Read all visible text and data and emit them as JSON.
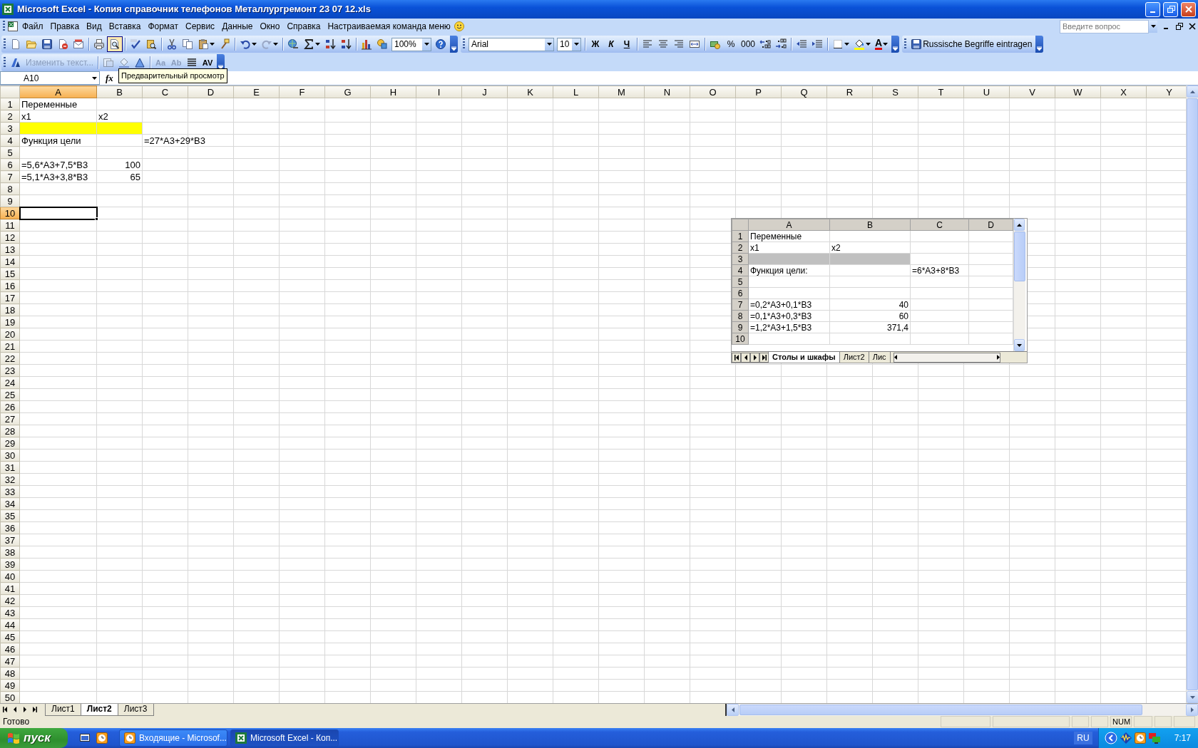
{
  "window": {
    "title": "Microsoft Excel - Копия справочник телефонов Металлургремонт 23 07 12.xls"
  },
  "menu_bar": {
    "items": [
      "Файл",
      "Правка",
      "Вид",
      "Вставка",
      "Формат",
      "Сервис",
      "Данные",
      "Окно",
      "Справка",
      "Настраиваемая команда меню"
    ],
    "help_placeholder": "Введите вопрос"
  },
  "standard_toolbar": {
    "groups": [
      [
        {
          "kind": "new",
          "hovered": false
        },
        {
          "kind": "open",
          "hovered": false
        },
        {
          "kind": "save",
          "hovered": false
        },
        {
          "kind": "permission",
          "hovered": false
        },
        {
          "kind": "email",
          "hovered": false
        }
      ],
      [
        {
          "kind": "print",
          "hovered": false
        },
        {
          "kind": "preview",
          "hovered": true
        }
      ],
      [
        {
          "kind": "spelling",
          "hovered": false
        },
        {
          "kind": "research",
          "hovered": false
        }
      ],
      [
        {
          "kind": "cut",
          "hovered": false
        },
        {
          "kind": "copy",
          "hovered": false
        },
        {
          "kind": "paste",
          "hovered": false
        },
        {
          "kind": "painter",
          "hovered": false
        }
      ],
      [
        {
          "kind": "undo",
          "hovered": false
        },
        {
          "kind": "redo",
          "hovered": false
        }
      ],
      [
        {
          "kind": "hyperlink",
          "hovered": false
        },
        {
          "kind": "autosum",
          "hovered": false
        },
        {
          "kind": "sort-asc",
          "hovered": false
        },
        {
          "kind": "sort-desc",
          "hovered": false
        }
      ],
      [
        {
          "kind": "chart",
          "hovered": false
        },
        {
          "kind": "drawing",
          "hovered": false
        },
        {
          "kind": "zoom",
          "value": "100%",
          "hovered": false
        },
        {
          "kind": "help",
          "hovered": false
        }
      ]
    ]
  },
  "formatting_toolbar": {
    "groups": [
      [
        {
          "kind": "font-combo",
          "value": "Arial"
        },
        {
          "kind": "size-combo",
          "value": "10"
        }
      ],
      [
        {
          "kind": "bold",
          "text": "Ж"
        },
        {
          "kind": "italic",
          "text": "К"
        },
        {
          "kind": "underline",
          "text": "Ч"
        }
      ],
      [
        {
          "kind": "align-left"
        },
        {
          "kind": "align-center"
        },
        {
          "kind": "align-right"
        },
        {
          "kind": "merge"
        }
      ],
      [
        {
          "kind": "currency"
        },
        {
          "kind": "percent",
          "text": "%"
        },
        {
          "kind": "thousands",
          "text": "000"
        },
        {
          "kind": "inc-decimal"
        },
        {
          "kind": "dec-decimal"
        }
      ],
      [
        {
          "kind": "dec-indent"
        },
        {
          "kind": "inc-indent"
        }
      ],
      [
        {
          "kind": "borders"
        },
        {
          "kind": "fill-color"
        },
        {
          "kind": "font-color",
          "text": "A"
        }
      ]
    ]
  },
  "custom_toolbar": {
    "button": "Russische Begriffe eintragen"
  },
  "wordart_toolbar": {
    "groups": [
      [
        {
          "kind": "wordart",
          "disabled": false
        },
        {
          "kind": "edit-text",
          "text": "Изменить текст...",
          "disabled": true
        }
      ],
      [
        {
          "kind": "gallery",
          "disabled": true
        },
        {
          "kind": "format",
          "disabled": true
        },
        {
          "kind": "shape",
          "disabled": false
        }
      ],
      [
        {
          "kind": "same-height",
          "text": "Aa",
          "disabled": true
        },
        {
          "kind": "vertical",
          "text": "Ab",
          "disabled": true
        },
        {
          "kind": "alignment",
          "disabled": false
        },
        {
          "kind": "spacing",
          "text": "AV",
          "disabled": false
        }
      ]
    ]
  },
  "tooltip": {
    "text": "Предварительный просмотр"
  },
  "formula_bar": {
    "name_box": "A10",
    "fx": "fx"
  },
  "sheet": {
    "columns": [
      {
        "label": "A",
        "selected": true
      },
      {
        "label": "B",
        "selected": false
      },
      {
        "label": "C",
        "selected": false
      },
      {
        "label": "D",
        "selected": false
      },
      {
        "label": "E",
        "selected": false
      },
      {
        "label": "F",
        "selected": false
      },
      {
        "label": "G",
        "selected": false
      },
      {
        "label": "H",
        "selected": false
      },
      {
        "label": "I",
        "selected": false
      },
      {
        "label": "J",
        "selected": false
      },
      {
        "label": "K",
        "selected": false
      },
      {
        "label": "L",
        "selected": false
      },
      {
        "label": "M",
        "selected": false
      },
      {
        "label": "N",
        "selected": false
      },
      {
        "label": "O",
        "selected": false
      },
      {
        "label": "P",
        "selected": false
      },
      {
        "label": "Q",
        "selected": false
      },
      {
        "label": "R",
        "selected": false
      },
      {
        "label": "S",
        "selected": false
      },
      {
        "label": "T",
        "selected": false
      },
      {
        "label": "U",
        "selected": false
      },
      {
        "label": "V",
        "selected": false
      },
      {
        "label": "W",
        "selected": false
      },
      {
        "label": "X",
        "selected": false
      },
      {
        "label": "Y",
        "selected": false
      }
    ],
    "rows": [
      {
        "label": "1",
        "selected": false,
        "cells": [
          {
            "kind": "text",
            "text": "Переменные",
            "highlighted": false,
            "active": false
          }
        ]
      },
      {
        "label": "2",
        "selected": false,
        "cells": [
          {
            "kind": "text",
            "text": "x1",
            "highlighted": false,
            "active": false
          },
          {
            "kind": "text",
            "text": "x2",
            "highlighted": false,
            "active": false
          }
        ]
      },
      {
        "label": "3",
        "selected": false,
        "cells": [
          {
            "kind": "empty",
            "highlighted": true,
            "active": false
          },
          {
            "kind": "empty",
            "highlighted": true,
            "active": false
          }
        ]
      },
      {
        "label": "4",
        "selected": false,
        "cells": [
          {
            "kind": "text",
            "text": "Функция цели",
            "highlighted": false,
            "active": false
          },
          null,
          {
            "kind": "text",
            "text": "=27*A3+29*B3",
            "highlighted": false,
            "active": false
          }
        ]
      },
      {
        "label": "5",
        "selected": false
      },
      {
        "label": "6",
        "selected": false,
        "cells": [
          {
            "kind": "text",
            "text": "=5,6*A3+7,5*B3",
            "highlighted": false,
            "active": false
          },
          {
            "kind": "number",
            "text": "100",
            "highlighted": false,
            "active": false
          }
        ]
      },
      {
        "label": "7",
        "selected": false,
        "cells": [
          {
            "kind": "text",
            "text": "=5,1*A3+3,8*B3",
            "highlighted": false,
            "active": false
          },
          {
            "kind": "number",
            "text": "65",
            "highlighted": false,
            "active": false
          }
        ]
      },
      {
        "label": "8",
        "selected": false
      },
      {
        "label": "9",
        "selected": false
      },
      {
        "label": "10",
        "selected": true,
        "cells": [
          {
            "kind": "empty",
            "highlighted": false,
            "active": true
          }
        ]
      },
      {
        "label": "11",
        "selected": false
      },
      {
        "label": "12",
        "selected": false
      },
      {
        "label": "13",
        "selected": false
      },
      {
        "label": "14",
        "selected": false
      },
      {
        "label": "15",
        "selected": false
      },
      {
        "label": "16",
        "selected": false
      },
      {
        "label": "17",
        "selected": false
      },
      {
        "label": "18",
        "selected": false
      },
      {
        "label": "19",
        "selected": false
      },
      {
        "label": "20",
        "selected": false
      },
      {
        "label": "21",
        "selected": false
      },
      {
        "label": "22",
        "selected": false
      },
      {
        "label": "23",
        "selected": false
      },
      {
        "label": "24",
        "selected": false
      },
      {
        "label": "25",
        "selected": false
      },
      {
        "label": "26",
        "selected": false
      },
      {
        "label": "27",
        "selected": false
      },
      {
        "label": "28",
        "selected": false
      },
      {
        "label": "29",
        "selected": false
      },
      {
        "label": "30",
        "selected": false
      },
      {
        "label": "31",
        "selected": false
      },
      {
        "label": "32",
        "selected": false
      },
      {
        "label": "33",
        "selected": false
      },
      {
        "label": "34",
        "selected": false
      },
      {
        "label": "35",
        "selected": false
      },
      {
        "label": "36",
        "selected": false
      },
      {
        "label": "37",
        "selected": false
      },
      {
        "label": "38",
        "selected": false
      },
      {
        "label": "39",
        "selected": false
      },
      {
        "label": "40",
        "selected": false
      },
      {
        "label": "41",
        "selected": false
      },
      {
        "label": "42",
        "selected": false
      },
      {
        "label": "43",
        "selected": false
      },
      {
        "label": "44",
        "selected": false
      },
      {
        "label": "45",
        "selected": false
      },
      {
        "label": "46",
        "selected": false
      },
      {
        "label": "47",
        "selected": false
      },
      {
        "label": "48",
        "selected": false
      },
      {
        "label": "49",
        "selected": false
      },
      {
        "label": "50",
        "selected": false
      }
    ]
  },
  "embedded_sheet": {
    "columns": [
      "A",
      "B",
      "C",
      "D"
    ],
    "rows": [
      {
        "label": "1",
        "cells": [
          {
            "kind": "text",
            "text": "Переменные",
            "highlighted": false
          }
        ]
      },
      {
        "label": "2",
        "cells": [
          {
            "kind": "text",
            "text": "x1",
            "highlighted": false
          },
          {
            "kind": "text",
            "text": "x2",
            "highlighted": false
          }
        ]
      },
      {
        "label": "3",
        "cells": [
          {
            "kind": "empty",
            "highlighted": true
          },
          {
            "kind": "empty",
            "highlighted": true
          }
        ]
      },
      {
        "label": "4",
        "cells": [
          {
            "kind": "text",
            "text": "Функция цели:",
            "highlighted": false
          },
          null,
          {
            "kind": "text",
            "text": "=6*A3+8*B3",
            "highlighted": false
          }
        ]
      },
      {
        "label": "5"
      },
      {
        "label": "6"
      },
      {
        "label": "7",
        "cells": [
          {
            "kind": "text",
            "text": "=0,2*A3+0,1*B3",
            "highlighted": false
          },
          {
            "kind": "number",
            "text": "40",
            "highlighted": false
          }
        ]
      },
      {
        "label": "8",
        "cells": [
          {
            "kind": "text",
            "text": "=0,1*A3+0,3*B3",
            "highlighted": false
          },
          {
            "kind": "number",
            "text": "60",
            "highlighted": false
          }
        ]
      },
      {
        "label": "9",
        "cells": [
          {
            "kind": "text",
            "text": "=1,2*A3+1,5*B3",
            "highlighted": false
          },
          {
            "kind": "number",
            "text": "371,4",
            "highlighted": false
          }
        ]
      },
      {
        "label": "10"
      }
    ],
    "tabs": [
      {
        "label": "Столы и шкафы",
        "selected": true
      },
      {
        "label": "Лист2",
        "selected": false
      },
      {
        "label": "Лис",
        "selected": false
      }
    ]
  },
  "sheet_tabs": [
    {
      "label": "Лист1",
      "selected": false
    },
    {
      "label": "Лист2",
      "selected": true
    },
    {
      "label": "Лист3",
      "selected": false
    }
  ],
  "status_bar": {
    "text": "Готово",
    "indicators": [
      "NUM"
    ]
  },
  "taskbar": {
    "start": "пуск",
    "tasks": [
      {
        "label": "Входящие - Microsof...",
        "kind": "mail",
        "selected": false
      },
      {
        "label": "Microsoft Excel - Коп...",
        "kind": "excel",
        "selected": true
      }
    ],
    "language": "RU",
    "clock": "7:17"
  }
}
